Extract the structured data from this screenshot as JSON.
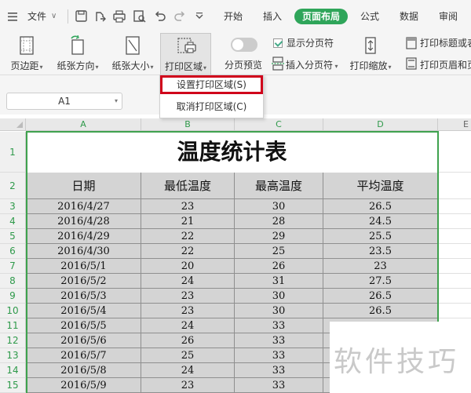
{
  "menubar": {
    "file_label": "文件",
    "tabs": [
      "开始",
      "插入",
      "页面布局",
      "公式",
      "数据",
      "审阅"
    ],
    "active_tab": "页面布局"
  },
  "ribbon": {
    "margin": "页边距",
    "orientation": "纸张方向",
    "paper_size": "纸张大小",
    "print_area": "打印区域",
    "page_break_preview": "分页预览",
    "show_page_breaks": "显示分页符",
    "insert_page_break": "插入分页符",
    "print_scale": "打印缩放",
    "print_title": "打印标题或表",
    "print_header_footer": "打印页眉和页"
  },
  "dropdown": {
    "set_print_area": "设置打印区域(S)",
    "cancel_print_area": "取消打印区域(C)"
  },
  "formula_bar": {
    "name_box": "A1"
  },
  "sheet": {
    "column_headers": [
      "A",
      "B",
      "C",
      "D",
      "E"
    ],
    "row_numbers": [
      "1",
      "2",
      "3",
      "4",
      "5",
      "6",
      "7",
      "8",
      "9",
      "10",
      "11",
      "12",
      "13",
      "14",
      "15"
    ],
    "title": "温度统计表",
    "headers": [
      "日期",
      "最低温度",
      "最高温度",
      "平均温度"
    ],
    "rows": [
      [
        "2016/4/27",
        "23",
        "30",
        "26.5"
      ],
      [
        "2016/4/28",
        "21",
        "28",
        "24.5"
      ],
      [
        "2016/4/29",
        "22",
        "29",
        "25.5"
      ],
      [
        "2016/4/30",
        "22",
        "25",
        "23.5"
      ],
      [
        "2016/5/1",
        "20",
        "26",
        "23"
      ],
      [
        "2016/5/2",
        "24",
        "31",
        "27.5"
      ],
      [
        "2016/5/3",
        "23",
        "30",
        "26.5"
      ],
      [
        "2016/5/4",
        "23",
        "30",
        "26.5"
      ],
      [
        "2016/5/5",
        "24",
        "33",
        ""
      ],
      [
        "2016/5/6",
        "26",
        "33",
        ""
      ],
      [
        "2016/5/7",
        "25",
        "33",
        ""
      ],
      [
        "2016/5/8",
        "24",
        "33",
        ""
      ],
      [
        "2016/5/9",
        "23",
        "33",
        ""
      ]
    ]
  },
  "watermark": "软件技巧",
  "colors": {
    "accent": "#2fa55a",
    "highlight_box": "#d0021b",
    "cell_fill": "#d4d4d4",
    "selection": "#3fa24e"
  }
}
